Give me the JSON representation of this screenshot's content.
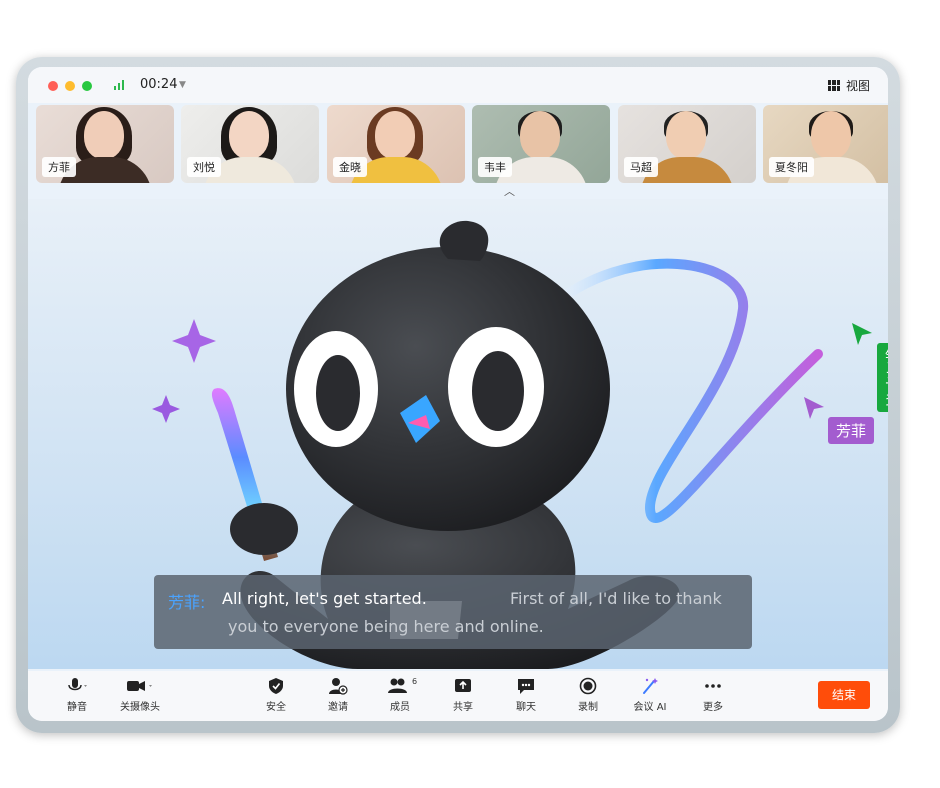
{
  "window": {
    "timer": "00:24",
    "view_label": "视图",
    "end_label": "结束"
  },
  "participants": [
    {
      "name": "方菲"
    },
    {
      "name": "刘悦"
    },
    {
      "name": "金晓"
    },
    {
      "name": "韦丰"
    },
    {
      "name": "马超"
    },
    {
      "name": "夏冬阳"
    }
  ],
  "caption": {
    "speaker": "芳菲:",
    "line1_a": "All right, let's get started.",
    "line1_b": "First of all, I'd like to thank",
    "line2": "you to everyone being here and online."
  },
  "cursors": [
    {
      "name": "钉三多",
      "color": "#18a83e"
    },
    {
      "name": "芳菲",
      "color": "#a35ccf"
    }
  ],
  "toolbar": {
    "items": [
      {
        "label": "静音",
        "icon": "microphone-icon"
      },
      {
        "label": "关摄像头",
        "icon": "camera-icon"
      },
      {
        "label": "安全",
        "icon": "shield-icon"
      },
      {
        "label": "邀请",
        "icon": "add-user-icon"
      },
      {
        "label": "成员",
        "icon": "members-icon",
        "badge": "6"
      },
      {
        "label": "共享",
        "icon": "share-icon"
      },
      {
        "label": "聊天",
        "icon": "chat-icon"
      },
      {
        "label": "录制",
        "icon": "record-icon"
      },
      {
        "label": "会议 AI",
        "icon": "ai-wand-icon"
      },
      {
        "label": "更多",
        "icon": "more-icon"
      }
    ]
  },
  "colors": {
    "end_button": "#ff4d0a",
    "caption_speaker": "#4aa3ff",
    "stroke_gradient_start": "#5aa8ff",
    "stroke_gradient_end": "#c45fdc"
  }
}
